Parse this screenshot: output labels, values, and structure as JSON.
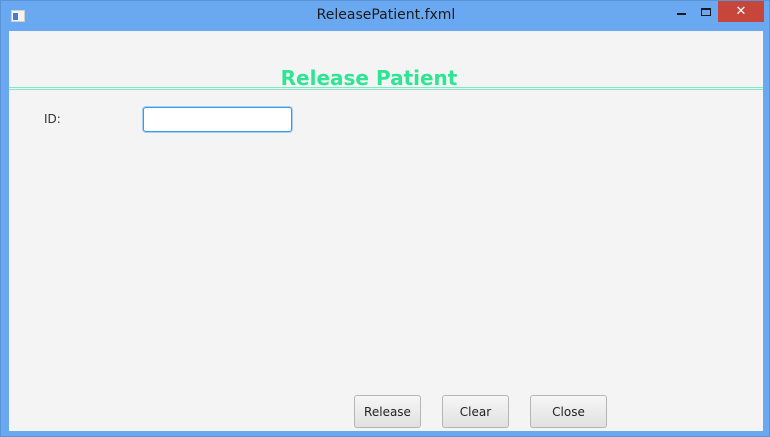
{
  "window": {
    "title": "ReleasePatient.fxml",
    "app_icon": "window-icon",
    "controls": {
      "minimize_icon": "minimize-icon",
      "maximize_icon": "maximize-icon",
      "close_label": "✕"
    }
  },
  "form": {
    "heading": "Release Patient",
    "id_label": "ID:",
    "id_value": "",
    "id_placeholder": ""
  },
  "actions": {
    "release_label": "Release",
    "clear_label": "Clear",
    "close_label": "Close"
  },
  "colors": {
    "titlebar": "#6aa9f2",
    "heading": "#2ee594",
    "close_button": "#c7463b",
    "content_bg": "#f4f4f4"
  }
}
